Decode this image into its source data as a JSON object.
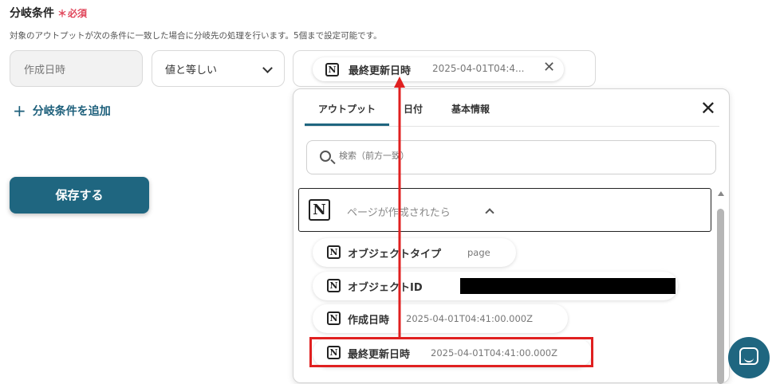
{
  "header": {
    "title": "分岐条件",
    "required_mark": "＊",
    "required_label": "必須",
    "description": "対象のアウトプットが次の条件に一致した場合に分岐先の処理を行います。5個まで設定可能です。"
  },
  "condition": {
    "field_placeholder": "作成日時",
    "operator": "値と等しい",
    "value_chip": {
      "label": "最終更新日時",
      "value": "2025-04-01T04:4...",
      "remove_glyph": "✕"
    }
  },
  "add_condition_label": "分岐条件を追加",
  "add_icon_glyph": "+",
  "save_button": "保存する",
  "dropdown": {
    "tabs": [
      "アウトプット",
      "日付",
      "基本情報"
    ],
    "active_tab": "アウトプット",
    "close_glyph": "✕",
    "search_placeholder": "検索（前方一致）",
    "group_label": "ページが作成されたら",
    "items": [
      {
        "label": "オブジェクトタイプ",
        "value": "page"
      },
      {
        "label": "オブジェクトID",
        "value": "",
        "redacted": true
      },
      {
        "label": "作成日時",
        "value": "2025-04-01T04:41:00.000Z"
      },
      {
        "label": "最終更新日時",
        "value": "2025-04-01T04:41:00.000Z",
        "highlighted": true
      }
    ]
  },
  "icons": {
    "notion": "notion-logo-icon",
    "logo_letter": "N"
  },
  "colors": {
    "accent": "#1f6680",
    "required": "#e0455a",
    "annotation": "#e02020"
  }
}
